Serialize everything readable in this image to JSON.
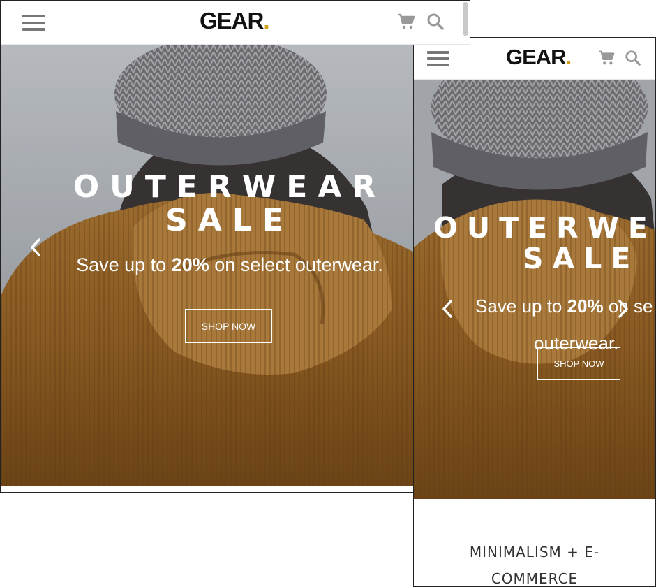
{
  "brand": {
    "logo_text": "GEAR",
    "logo_dot": ".",
    "accent_color": "#d4a017"
  },
  "header": {
    "menu_icon": "hamburger-menu-icon",
    "cart_icon": "shopping-cart-icon",
    "search_icon": "search-icon"
  },
  "hero": {
    "title_line1": "OUTERWEAR",
    "title_line2": "SALE",
    "subtitle_prefix": "Save up to ",
    "subtitle_highlight": "20%",
    "subtitle_suffix": " on select outerwear.",
    "subtitle_wrap_a": " on se",
    "subtitle_wrap_b": "outerwear.",
    "button_label": "SHOP NOW",
    "prev_icon": "chevron-left-icon",
    "next_icon": "chevron-right-icon"
  },
  "section": {
    "tagline": "MINIMALISM + E-COMMERCE",
    "tagline_line1": "MINIMALISM + E-",
    "tagline_line2": "COMMERCE"
  }
}
